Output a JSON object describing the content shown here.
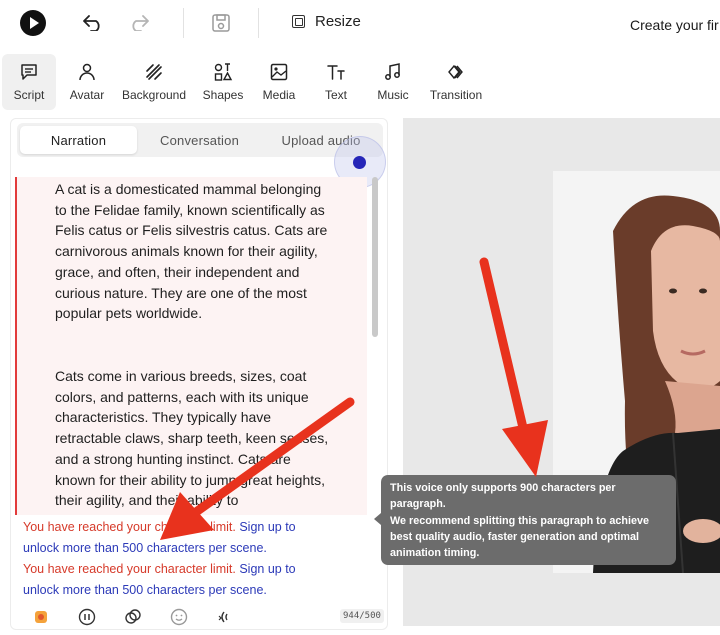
{
  "header": {
    "resize_label": "Resize",
    "title": "Create your fir",
    "icons": [
      "logo-icon",
      "undo-icon",
      "redo-icon",
      "save-icon",
      "resize-icon"
    ]
  },
  "toolbar": {
    "items": [
      {
        "label": "Script",
        "icon": "script-icon",
        "active": true
      },
      {
        "label": "Avatar",
        "icon": "avatar-icon"
      },
      {
        "label": "Background",
        "icon": "background-icon"
      },
      {
        "label": "Shapes",
        "icon": "shapes-icon"
      },
      {
        "label": "Media",
        "icon": "media-icon"
      },
      {
        "label": "Text",
        "icon": "text-icon"
      },
      {
        "label": "Music",
        "icon": "music-icon"
      },
      {
        "label": "Transition",
        "icon": "transition-icon"
      }
    ]
  },
  "script_panel": {
    "tabs": [
      {
        "label": "Narration",
        "active": true
      },
      {
        "label": "Conversation"
      },
      {
        "label": "Upload audio"
      }
    ],
    "paragraphs": [
      "A cat is a domesticated mammal belonging to the Felidae family, known scientifically as Felis catus or Felis silvestris catus. Cats are carnivorous animals known for their agility, grace, and often, their independent and curious nature. They are one of the most popular pets worldwide.",
      "Cats come in various breeds, sizes, coat colors, and patterns, each with its unique characteristics. They typically have retractable claws, sharp teeth, keen senses, and a strong hunting instinct. Cats are known for their ability to jump great heights, their agility, and their ability to"
    ],
    "warnings": [
      {
        "red": "You have reached your character limit.",
        "blue1": " Sign up to",
        "blue2": "unlock more than 500 characters per scene."
      },
      {
        "red": "You have reached your character limit.",
        "blue1": " Sign up to",
        "blue2": "unlock more than 500 characters per scene."
      }
    ],
    "counter": "944/500",
    "bottom_icons": [
      "voice-icon",
      "pause-icon",
      "gesture-icon",
      "emotion-icon",
      "sound-icon"
    ]
  },
  "tooltip": {
    "line1": "This voice only supports 900 characters per paragraph.",
    "line2": "We recommend splitting this paragraph to achieve best quality audio, faster generation and optimal animation timing."
  },
  "colors": {
    "warning_red": "#d63a2a",
    "link_blue": "#2c3ab8",
    "arrow_red": "#e8321d",
    "text_area_bg": "#fdf3f3"
  }
}
